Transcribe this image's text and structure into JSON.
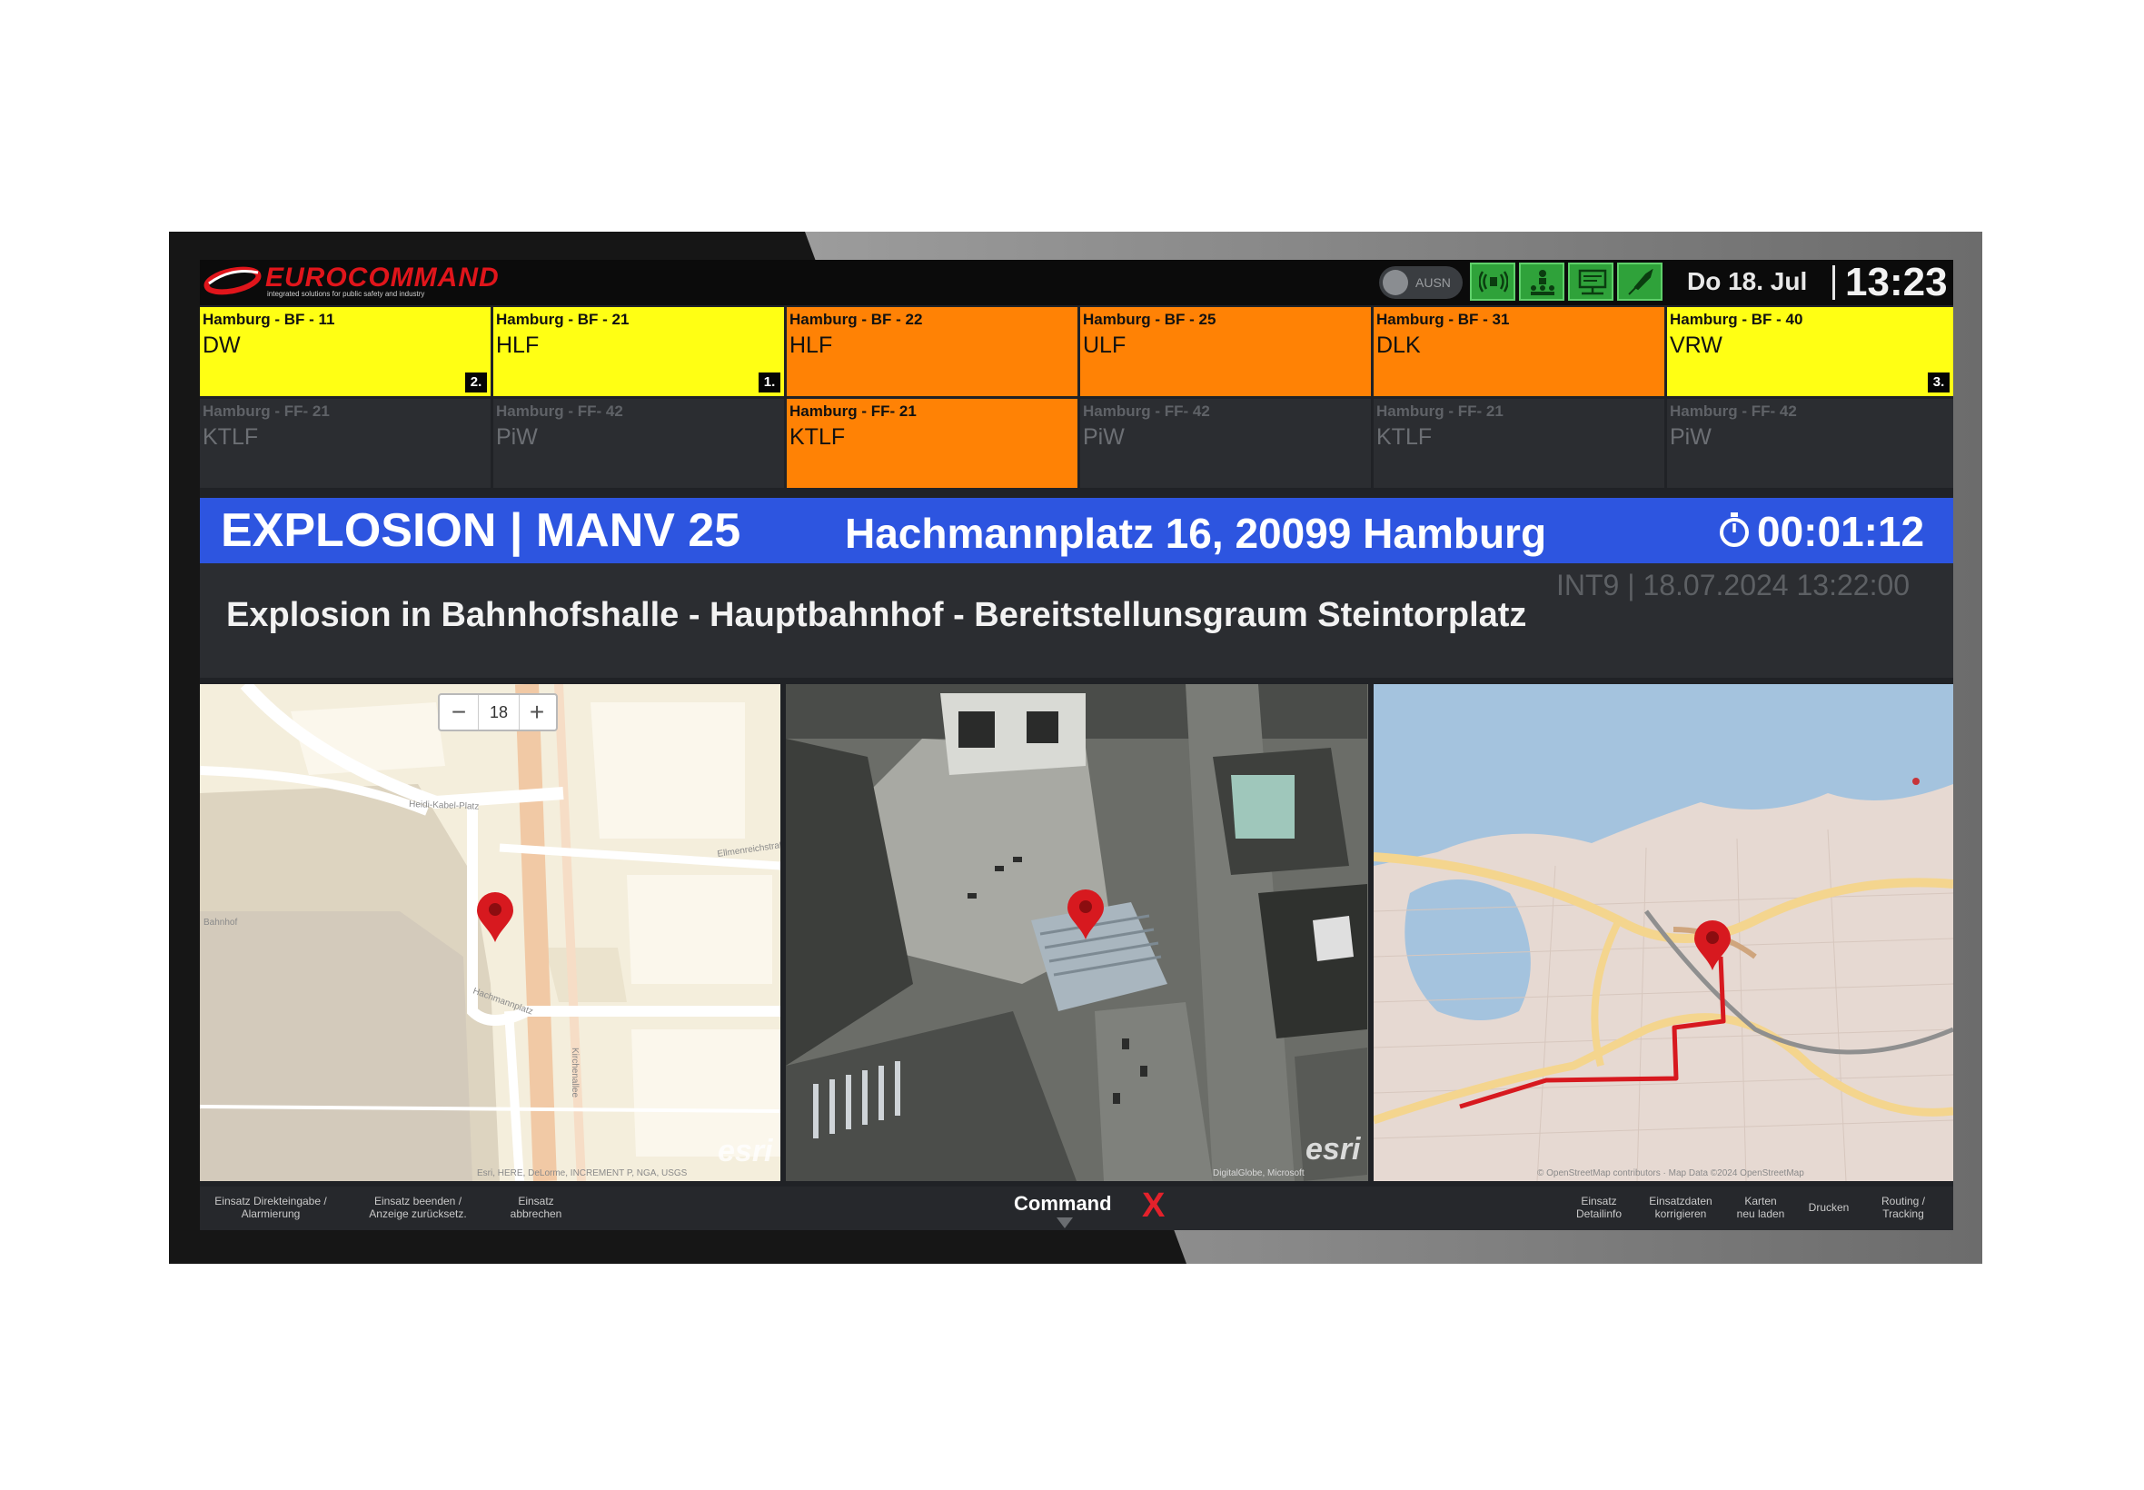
{
  "header": {
    "brand_name": "EUROCOMMAND",
    "brand_tagline": "integrated solutions for public safety and industry",
    "toggle_label": "AUSN",
    "status_icons": [
      "alarm-signal-icon",
      "unit-structure-icon",
      "monitor-network-icon",
      "satellite-icon"
    ],
    "date": "Do 18. Jul",
    "time": "13:23"
  },
  "units": {
    "row1": [
      {
        "station": "Hamburg - BF - 11",
        "type": "DW",
        "badge": "2."
      },
      {
        "station": "Hamburg - BF - 21",
        "type": "HLF",
        "badge": "1."
      },
      {
        "station": "Hamburg - BF - 22",
        "type": "HLF",
        "badge": ""
      },
      {
        "station": "Hamburg - BF - 25",
        "type": "ULF",
        "badge": ""
      },
      {
        "station": "Hamburg - BF - 31",
        "type": "DLK",
        "badge": ""
      },
      {
        "station": "Hamburg - BF - 40",
        "type": "VRW",
        "badge": "3."
      }
    ],
    "row2": [
      {
        "station": "Hamburg - FF- 21",
        "type": "KTLF"
      },
      {
        "station": "Hamburg - FF- 42",
        "type": "PiW"
      },
      {
        "station": "Hamburg - FF- 21",
        "type": "KTLF"
      },
      {
        "station": "Hamburg - FF- 42",
        "type": "PiW"
      },
      {
        "station": "Hamburg - FF- 21",
        "type": "KTLF"
      },
      {
        "station": "Hamburg - FF- 42",
        "type": "PiW"
      }
    ],
    "colors": {
      "yellow": "#ffff14",
      "orange": "#ff8205",
      "inactive": "#2b2d31"
    }
  },
  "incident": {
    "title": "EXPLOSION | MANV 25",
    "address": "Hachmannplatz 16, 20099 Hamburg",
    "elapsed": "00:01:12",
    "meta": "INT9 | 18.07.2024 13:22:00",
    "description": "Explosion in Bahnhofshalle - Hauptbahnhof - Bereitstellunsgraum Steintorplatz",
    "banner_color": "#2d55e0"
  },
  "maps": {
    "zoom_level": "18",
    "zoom_minus": "−",
    "zoom_plus": "+",
    "street_labels": [
      "Heidi-Kabel-Platz",
      "Ellmenreichstraße",
      "Hachmannplatz",
      "Kirchenallee",
      "Bahnhof"
    ],
    "esri_label": "esri",
    "attribution_street": "Esri, HERE, DeLorme, INCREMENT P, NGA, USGS",
    "attribution_satellite": "DigitalGlobe, Microsoft",
    "attribution_overview": "© OpenStreetMap contributors · Map Data ©2024 OpenStreetMap",
    "marker_color": "#d7191f",
    "route_color": "#d7191f"
  },
  "footer": {
    "left_buttons": [
      {
        "line1": "Einsatz Direkteingabe /",
        "line2": "Alarmierung"
      },
      {
        "line1": "Einsatz beenden /",
        "line2": "Anzeige zurücksetz."
      },
      {
        "line1": "Einsatz",
        "line2": "abbrechen"
      }
    ],
    "brand": "Command",
    "brand_suffix": "X",
    "right_buttons": [
      {
        "line1": "Einsatz",
        "line2": "Detailinfo"
      },
      {
        "line1": "Einsatzdaten",
        "line2": "korrigieren"
      },
      {
        "line1": "Karten",
        "line2": "neu laden"
      },
      {
        "line1": "Drucken",
        "line2": ""
      },
      {
        "line1": "Routing /",
        "line2": "Tracking"
      }
    ]
  }
}
